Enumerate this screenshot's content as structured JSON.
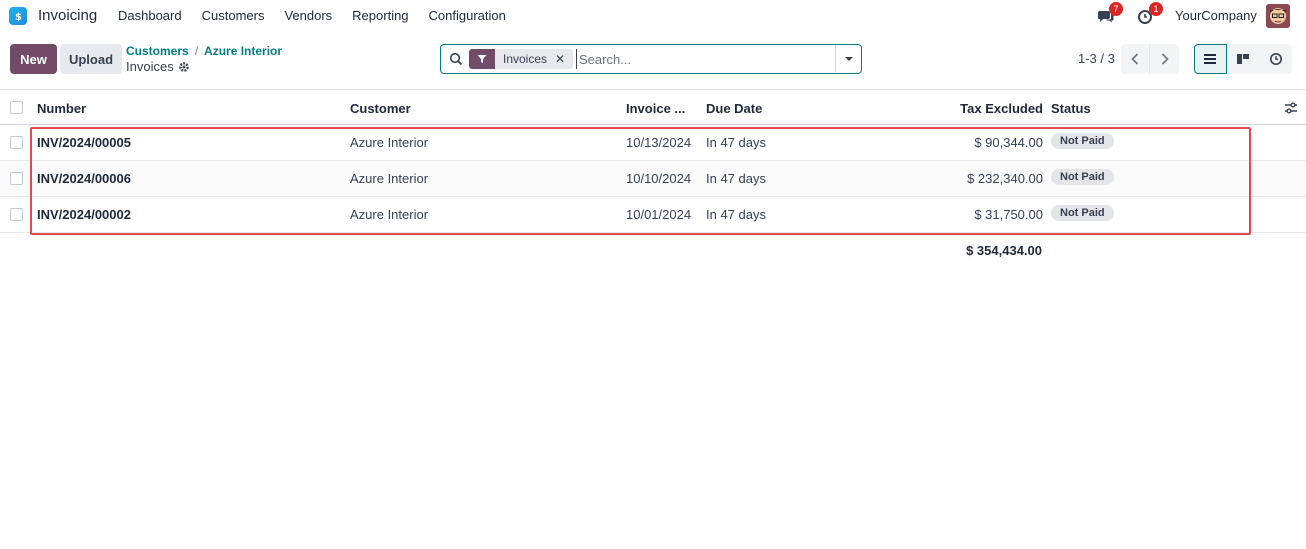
{
  "navbar": {
    "app_name": "Invoicing",
    "menu": [
      "Dashboard",
      "Customers",
      "Vendors",
      "Reporting",
      "Configuration"
    ],
    "messages_count": "7",
    "activities_count": "1",
    "company": "YourCompany",
    "brand_color": "#714b67",
    "accent_color": "#017e84"
  },
  "control": {
    "new_label": "New",
    "upload_label": "Upload",
    "breadcrumb": [
      "Customers",
      "Azure Interior"
    ],
    "current": "Invoices",
    "search": {
      "facet_label": "Invoices",
      "placeholder": "Search..."
    },
    "pager": "1-3 / 3"
  },
  "table": {
    "columns": {
      "number": "Number",
      "customer": "Customer",
      "invoice_date": "Invoice ...",
      "due_date": "Due Date",
      "tax_excluded": "Tax Excluded",
      "status": "Status"
    },
    "rows": [
      {
        "number": "INV/2024/00005",
        "customer": "Azure Interior",
        "invoice_date": "10/13/2024",
        "due_date": "In 47 days",
        "tax_excluded": "$ 90,344.00",
        "status": "Not Paid"
      },
      {
        "number": "INV/2024/00006",
        "customer": "Azure Interior",
        "invoice_date": "10/10/2024",
        "due_date": "In 47 days",
        "tax_excluded": "$ 232,340.00",
        "status": "Not Paid"
      },
      {
        "number": "INV/2024/00002",
        "customer": "Azure Interior",
        "invoice_date": "10/01/2024",
        "due_date": "In 47 days",
        "tax_excluded": "$ 31,750.00",
        "status": "Not Paid"
      }
    ],
    "total": "$ 354,434.00"
  }
}
